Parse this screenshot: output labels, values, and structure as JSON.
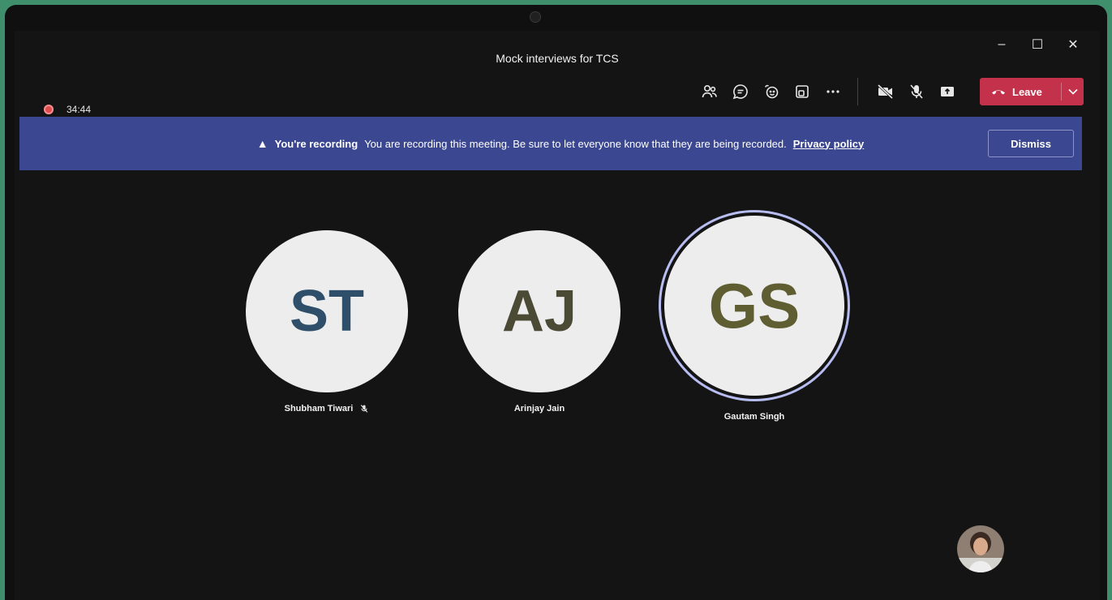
{
  "window": {
    "title": "Mock interviews for TCS"
  },
  "window_controls": {
    "minimize": "–",
    "maximize": "☐",
    "close": "✕"
  },
  "timer": {
    "value": "34:44"
  },
  "toolbar": {
    "buttons": [
      "people-icon",
      "chat-icon",
      "reactions-icon",
      "rooms-icon",
      "more-icon",
      "camera-off-icon",
      "mic-off-icon",
      "share-icon"
    ],
    "leave_label": "Leave"
  },
  "banner": {
    "title": "You're recording",
    "message": "You are recording this meeting. Be sure to let everyone know that they are being recorded.",
    "link": "Privacy policy",
    "dismiss": "Dismiss"
  },
  "participants": [
    {
      "initials": "ST",
      "name": "Shubham Tiwari",
      "color": "#2e4e6a",
      "muted": true
    },
    {
      "initials": "AJ",
      "name": "Arinjay Jain",
      "color": "#4a4a35",
      "muted": false
    },
    {
      "initials": "GS",
      "name": "Gautam Singh",
      "color": "#5f5e32",
      "speaking": true
    }
  ],
  "colors": {
    "leave": "#c4314b",
    "banner": "#3b4790",
    "background": "#141414"
  }
}
